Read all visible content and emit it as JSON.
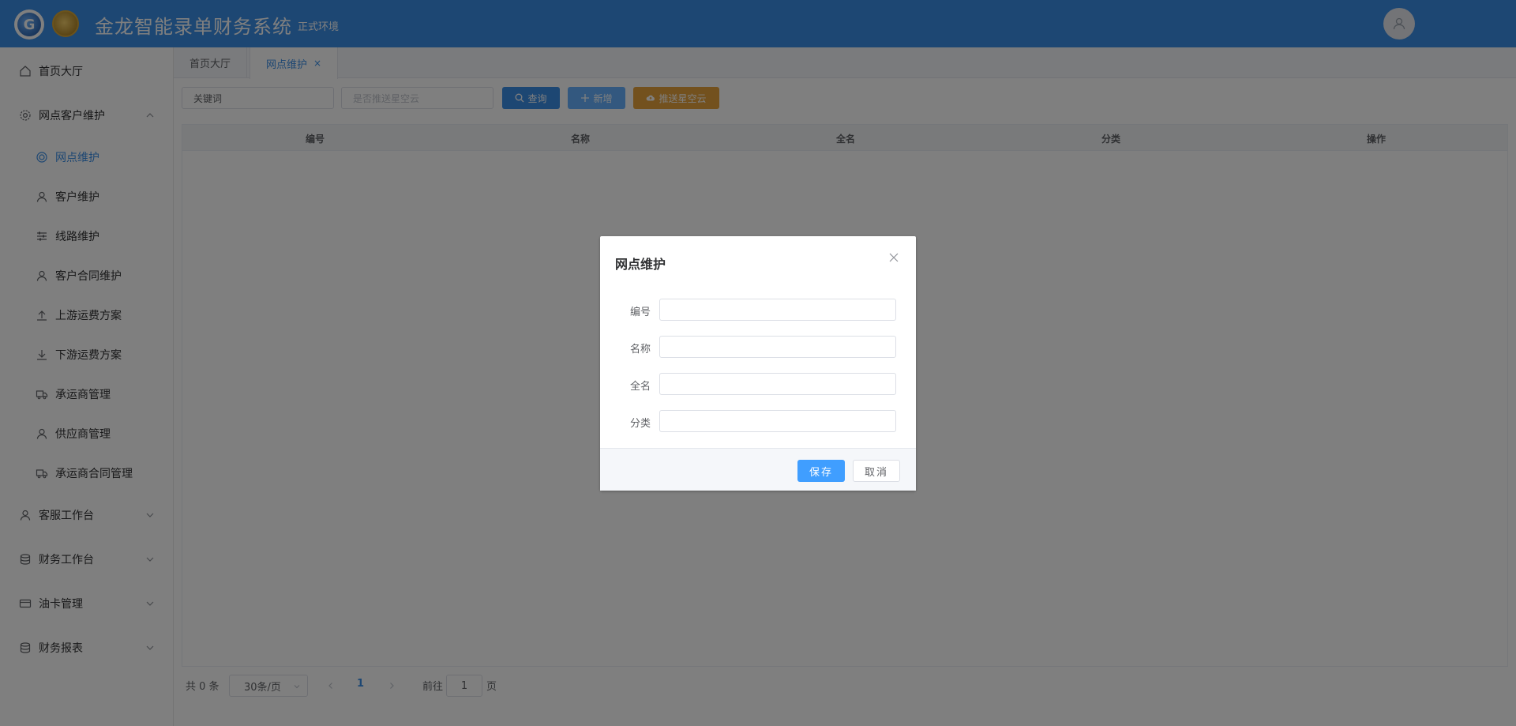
{
  "header": {
    "title": "金龙智能录单财务系统",
    "env": "正式环境"
  },
  "sidebar": {
    "items": [
      {
        "label": "首页大厅",
        "icon": "home-icon"
      },
      {
        "label": "网点客户维护",
        "icon": "gear-icon",
        "expanded": true
      },
      {
        "label": "客服工作台",
        "icon": "user-icon"
      },
      {
        "label": "财务工作台",
        "icon": "database-icon"
      },
      {
        "label": "油卡管理",
        "icon": "card-icon"
      },
      {
        "label": "财务报表",
        "icon": "database-icon"
      }
    ],
    "sub_items": [
      {
        "label": "网点维护",
        "icon": "target-icon",
        "active": true
      },
      {
        "label": "客户维护",
        "icon": "user-icon"
      },
      {
        "label": "线路维护",
        "icon": "sliders-icon"
      },
      {
        "label": "客户合同维护",
        "icon": "user-icon"
      },
      {
        "label": "上游运费方案",
        "icon": "upload-icon"
      },
      {
        "label": "下游运费方案",
        "icon": "download-icon"
      },
      {
        "label": "承运商管理",
        "icon": "truck-icon"
      },
      {
        "label": "供应商管理",
        "icon": "user-icon"
      },
      {
        "label": "承运商合同管理",
        "icon": "truck-icon"
      }
    ]
  },
  "tabs": [
    {
      "label": "首页大厅"
    },
    {
      "label": "网点维护",
      "active": true,
      "closable": "×"
    }
  ],
  "toolbar": {
    "keyword_value": "关键词",
    "push_placeholder": "是否推送星空云",
    "query_label": "查询",
    "add_label": "新增",
    "push_label": "推送星空云"
  },
  "table": {
    "columns": [
      "编号",
      "名称",
      "全名",
      "分类",
      "操作"
    ]
  },
  "pagination": {
    "total": "共 0 条",
    "page_size": "30条/页",
    "current_page": "1",
    "goto_prefix": "前往",
    "goto_value": "1",
    "goto_suffix": "页"
  },
  "dialog": {
    "title": "网点维护",
    "fields": [
      {
        "label": "编号",
        "value": ""
      },
      {
        "label": "名称",
        "value": ""
      },
      {
        "label": "全名",
        "value": ""
      },
      {
        "label": "分类",
        "value": ""
      }
    ],
    "save_label": "保存",
    "cancel_label": "取消"
  },
  "colors": {
    "primary": "#3a8ee6",
    "push_button": "#e6a23c",
    "overlay": "rgba(0,0,0,0.5)"
  }
}
